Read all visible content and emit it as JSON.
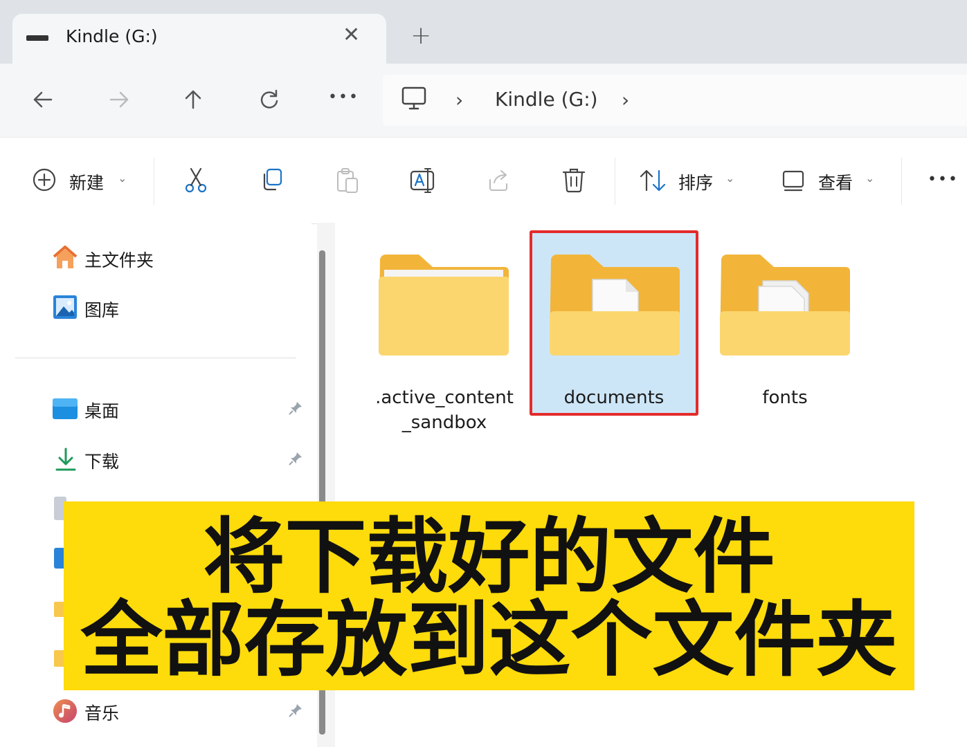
{
  "tab": {
    "title": "Kindle (G:)",
    "close": "✕",
    "new_tab": "+"
  },
  "nav": {
    "back": "back-icon",
    "forward": "forward-icon",
    "up": "up-icon",
    "refresh": "refresh-icon",
    "more": "•••",
    "breadcrumb": {
      "sep1": "›",
      "location": "Kindle (G:)",
      "sep2": "›"
    }
  },
  "toolbar": {
    "new_label": "新建",
    "sort_label": "排序",
    "view_label": "查看",
    "more": "•••",
    "chevron": "⌄"
  },
  "sidebar": {
    "home": "主文件夹",
    "gallery": "图库",
    "desktop": "桌面",
    "downloads": "下载",
    "music": "音乐"
  },
  "folders": [
    {
      "name_line1": ".active_content",
      "name_line2": "_sandbox"
    },
    {
      "name_line1": "documents"
    },
    {
      "name_line1": "fonts"
    }
  ],
  "banner": {
    "line1": "将下载好的文件",
    "line2": "全部存放到这个文件夹"
  },
  "colors": {
    "accent_folder": "#f8c84c",
    "selection": "#cde6f7",
    "highlight_border": "#e32b2b",
    "banner_bg": "#fedb0b"
  }
}
